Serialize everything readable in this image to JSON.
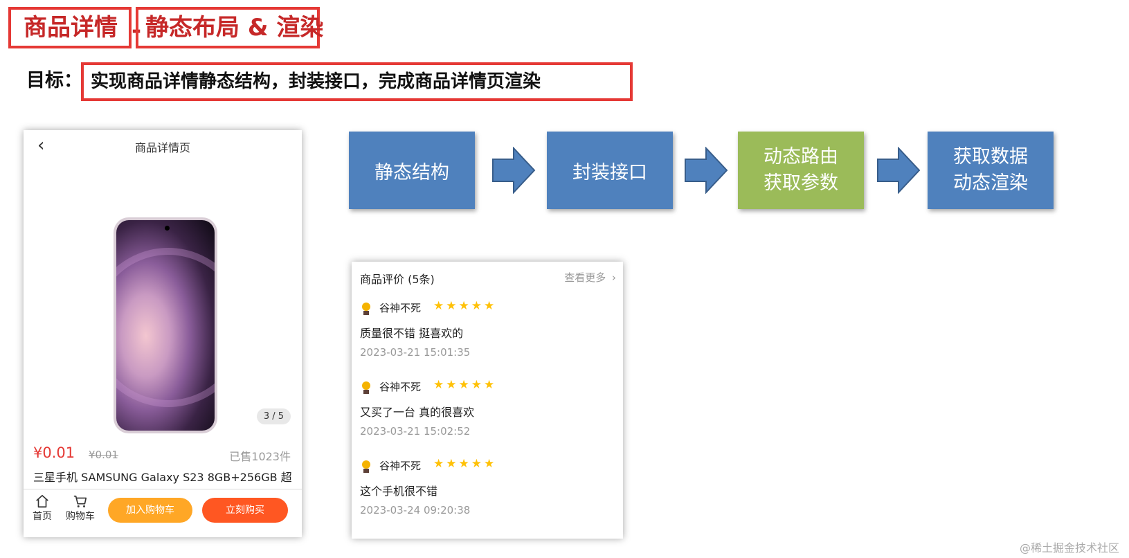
{
  "header": {
    "title_part1": "商品详情",
    "separator": "-",
    "title_part2": "静态布局 & 渲染"
  },
  "goal": {
    "label": "目标：",
    "text": "实现商品详情静态结构，封装接口，完成商品详情页渲染"
  },
  "phone_page": {
    "back_icon": "chevron-left-icon",
    "title": "商品详情页",
    "page_indicator": "3 / 5",
    "price": "¥0.01",
    "old_price": "¥0.01",
    "sold": "已售1023件",
    "product_name": "三星手机 SAMSUNG Galaxy S23 8GB+256GB 超",
    "nav": {
      "home_label": "首页",
      "cart_label": "购物车",
      "add_cart_label": "加入购物车",
      "buy_label": "立刻购买"
    },
    "colors": {
      "price": "#e53935",
      "add_cart_button": "#ffa726",
      "buy_button": "#ff5722"
    }
  },
  "flow": {
    "steps": [
      {
        "line1": "静态结构",
        "line2": "",
        "color": "#4f81bd"
      },
      {
        "line1": "封装接口",
        "line2": "",
        "color": "#4f81bd"
      },
      {
        "line1": "动态路由",
        "line2": "获取参数",
        "color": "#9bbb59"
      },
      {
        "line1": "获取数据",
        "line2": "动态渲染",
        "color": "#4f81bd"
      }
    ],
    "arrow_color": "#4f81bd"
  },
  "reviews": {
    "header": "商品评价 (5条)",
    "more": "查看更多",
    "items": [
      {
        "user": "谷神不死",
        "stars": 5,
        "content": "质量很不错 挺喜欢的",
        "time": "2023-03-21 15:01:35"
      },
      {
        "user": "谷神不死",
        "stars": 5,
        "content": "又买了一台 真的很喜欢",
        "time": "2023-03-21 15:02:52"
      },
      {
        "user": "谷神不死",
        "stars": 5,
        "content": "这个手机很不错",
        "time": "2023-03-24 09:20:38"
      }
    ],
    "star_color": "#ffc107"
  },
  "watermark": "@稀土掘金技术社区"
}
